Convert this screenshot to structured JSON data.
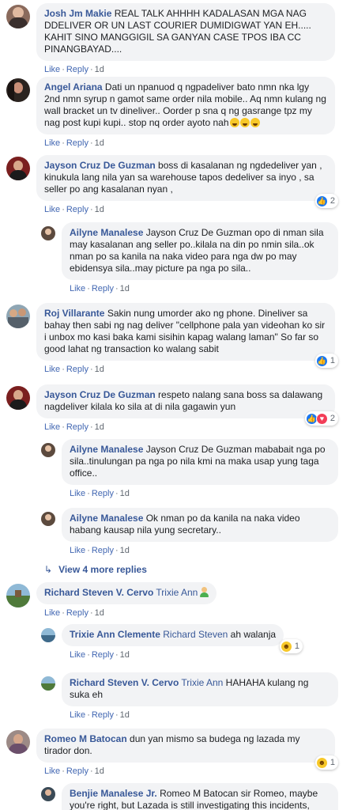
{
  "actions": {
    "like": "Like",
    "reply": "Reply",
    "sep": "·"
  },
  "colors": {
    "name": "#385898",
    "link": "#4267b2",
    "bubble": "#f2f3f5"
  },
  "comments": [
    {
      "author": "Josh Jm Makie",
      "text": "REAL TALK AHHHH KADALASAN MGA NAG DDELIVER OR UN LAST COURIER DUMIDIGWAT YAN EH..... KAHIT SINO MANGGIGIL SA GANYAN CASE TPOS IBA CC PINANGBAYAD....",
      "time": "1d"
    },
    {
      "author": "Angel Ariana",
      "text": "Dati un npanuod q ngpadeliver bato nmn nka lgy 2nd nmn syrup n gamot same order nila mobile.. Aq nmn kulang ng wall bracket un tv dineliver.. Oorder p sna q ng gasrange tpz my nag post kupi kupi.. stop nq order ayoto nah",
      "emojis": [
        "laughing-tears-emoji",
        "laughing-tears-emoji",
        "laughing-tears-emoji"
      ],
      "time": "1d"
    },
    {
      "author": "Jayson Cruz De Guzman",
      "text": "boss di kasalanan ng ngdedeliver yan , kinukula lang nila yan sa warehouse tapos dedeliver sa inyo , sa seller po ang kasalanan nyan ,",
      "time": "1d",
      "reactions": {
        "types": [
          "like"
        ],
        "count": "2"
      },
      "replies": [
        {
          "author": "Ailyne Manalese",
          "text": "Jayson Cruz De Guzman opo di nman sila may kasalanan ang seller po..kilala na din po nmin sila..ok nman po sa kanila na naka video para nga dw po may ebidensya sila..may picture pa nga po sila..",
          "time": "1d"
        }
      ]
    },
    {
      "author": "Roj Villarante",
      "text": "Sakin nung umorder ako ng phone. Dineliver sa bahay then sabi ng nag deliver \"cellphone pala yan videohan ko sir i unbox mo kasi baka kami sisihin kapag walang laman\" So far so good lahat ng transaction ko walang sabit",
      "time": "1d",
      "reactions": {
        "types": [
          "like"
        ],
        "count": "1"
      }
    },
    {
      "author": "Jayson Cruz De Guzman",
      "text": "respeto nalang sana boss sa dalawang nagdeliver kilala ko sila at di nila gagawin yun",
      "time": "1d",
      "reactions": {
        "types": [
          "like",
          "love"
        ],
        "count": "2"
      },
      "replies": [
        {
          "author": "Ailyne Manalese",
          "text": "Jayson Cruz De Guzman mababait nga po sila..tinulungan pa nga po nila kmi na maka usap yung taga office..",
          "time": "1d"
        },
        {
          "author": "Ailyne Manalese",
          "text": "Ok nman po da kanila na naka video habang kausap nila yung secretary..",
          "time": "1d"
        }
      ],
      "more_replies": "View 4 more replies"
    },
    {
      "author": "Richard Steven V. Cervo",
      "mention": "Trixie Ann",
      "emojis": [
        "man-emoji"
      ],
      "text": "",
      "time": "1d",
      "replies": [
        {
          "author": "Trixie Ann Clemente",
          "mention": "Richard Steven",
          "text": "ah walanja",
          "time": "1d",
          "reactions": {
            "types": [
              "haha"
            ],
            "count": "1"
          }
        },
        {
          "author": "Richard Steven V. Cervo",
          "mention": "Trixie Ann",
          "text": "HAHAHA kulang ng suka eh",
          "time": "1d"
        }
      ]
    },
    {
      "author": "Romeo M Batocan",
      "text": "dun yan mismo sa budega ng lazada my tirador don.",
      "time": "1d",
      "reactions": {
        "types": [
          "haha"
        ],
        "count": "1"
      },
      "replies": [
        {
          "author": "Benjie Manalese Jr.",
          "text": "Romeo M Batocan sir Romeo, maybe you're right, but Lazada is still investigating this incidents, thank you",
          "time": ""
        }
      ]
    }
  ]
}
